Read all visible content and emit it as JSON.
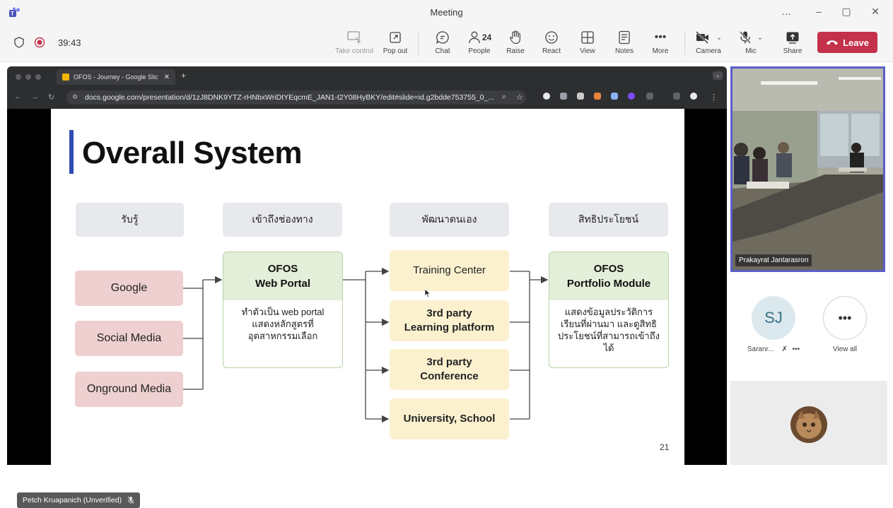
{
  "window": {
    "title": "Meeting",
    "controls": [
      "…",
      "–",
      "▢",
      "✕"
    ]
  },
  "toolbar": {
    "timer": "39:43",
    "buttons": [
      {
        "label": "Take control",
        "icon": "take-control-icon"
      },
      {
        "label": "Pop out",
        "icon": "pop-out-icon"
      },
      {
        "label": "Chat",
        "icon": "chat-icon"
      },
      {
        "label": "People",
        "icon": "people-icon",
        "count": "24"
      },
      {
        "label": "Raise",
        "icon": "raise-hand-icon"
      },
      {
        "label": "React",
        "icon": "react-icon"
      },
      {
        "label": "View",
        "icon": "view-icon"
      },
      {
        "label": "Notes",
        "icon": "notes-icon"
      },
      {
        "label": "More",
        "icon": "more-icon"
      },
      {
        "label": "Camera",
        "icon": "camera-off-icon"
      },
      {
        "label": "Mic",
        "icon": "mic-off-icon"
      },
      {
        "label": "Share",
        "icon": "share-icon"
      }
    ],
    "leave_label": "Leave",
    "colors": {
      "leave": "#c4314b",
      "accent": "#5b5fc7"
    }
  },
  "browser": {
    "tab_title": "OFOS - Journey - Google Slic",
    "url": "docs.google.com/presentation/d/1zJ8DNK9YTZ-rHNbxWriDtYEqcmE_JAN1-t2Y08HyBKY/edit#slide=id.g2bdde753755_0_..."
  },
  "slide": {
    "title": "Overall System",
    "headers": [
      "รับรู้",
      "เข้าถึงช่องทาง",
      "พัฒนาตนเอง",
      "สิทธิประโยชน์"
    ],
    "sources": [
      "Google",
      "Social Media",
      "Onground Media"
    ],
    "portal": {
      "title_line1": "OFOS",
      "title_line2": "Web Portal",
      "body": "ทำตัวเป็น web portal แสดงหลักสูตรที่อุตสาหกรรมเลือก"
    },
    "channels": [
      {
        "line1": "Training Center",
        "line2": ""
      },
      {
        "line1": "3rd party",
        "line2": "Learning platform"
      },
      {
        "line1": "3rd party",
        "line2": "Conference"
      },
      {
        "line1": "University, School",
        "line2": ""
      }
    ],
    "portfolio": {
      "title_line1": "OFOS",
      "title_line2": "Portfolio Module",
      "body": "แสดงข้อมูลประวัติการเรียนที่ผ่านมา และดูสิทธิประโยชน์ที่สามารถเข้าถึงได้"
    },
    "page_number": "21"
  },
  "presenter": {
    "name": "Petch Kruapanich (Unverified)"
  },
  "participants": {
    "video_name": "Prakayrat Jantarasron",
    "p1_initials": "SJ",
    "p1_name": "Saranr...",
    "view_all": "View all"
  }
}
